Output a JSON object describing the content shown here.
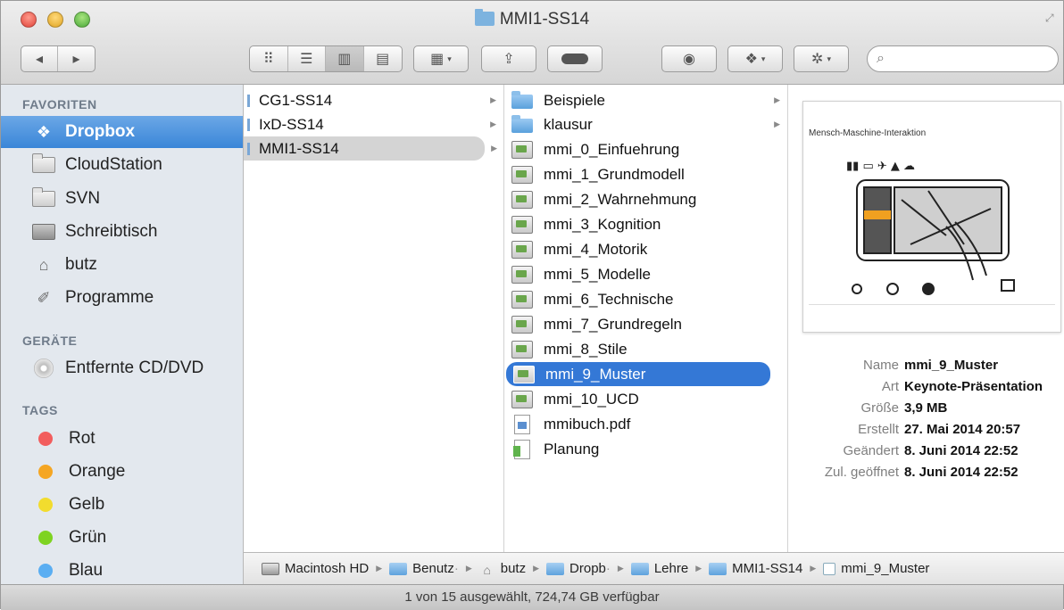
{
  "window": {
    "title": "MMI1-SS14"
  },
  "toolbar": {
    "back_icon": "chevron-left-icon",
    "forward_icon": "chevron-right-icon",
    "view_modes": [
      "icon-view",
      "list-view",
      "column-view",
      "coverflow-view"
    ],
    "active_view": "column-view",
    "search_placeholder": ""
  },
  "sidebar": {
    "favorites_header": "FAVORITEN",
    "favorites": [
      {
        "label": "Dropbox",
        "icon": "dropbox-icon",
        "selected": true
      },
      {
        "label": "CloudStation",
        "icon": "folder-icon"
      },
      {
        "label": "SVN",
        "icon": "folder-icon"
      },
      {
        "label": "Schreibtisch",
        "icon": "desktop-icon"
      },
      {
        "label": "butz",
        "icon": "home-icon"
      },
      {
        "label": "Programme",
        "icon": "applications-icon"
      }
    ],
    "devices_header": "GERÄTE",
    "devices": [
      {
        "label": "Entfernte CD/DVD",
        "icon": "cd-icon"
      }
    ],
    "tags_header": "TAGS",
    "tags": [
      {
        "label": "Rot",
        "color": "#f25d5d"
      },
      {
        "label": "Orange",
        "color": "#f5a623"
      },
      {
        "label": "Gelb",
        "color": "#f2dc2e"
      },
      {
        "label": "Grün",
        "color": "#7ed321"
      },
      {
        "label": "Blau",
        "color": "#5aaef2"
      }
    ]
  },
  "column1": {
    "items": [
      {
        "label": "CG1-SS14"
      },
      {
        "label": "IxD-SS14"
      },
      {
        "label": "MMI1-SS14",
        "open": true
      }
    ]
  },
  "column2": {
    "items": [
      {
        "label": "Beispiele",
        "type": "folder"
      },
      {
        "label": "klausur",
        "type": "folder"
      },
      {
        "label": "mmi_0_Einfuehrung",
        "type": "keynote"
      },
      {
        "label": "mmi_1_Grundmodell",
        "type": "keynote"
      },
      {
        "label": "mmi_2_Wahrnehmung",
        "type": "keynote"
      },
      {
        "label": "mmi_3_Kognition",
        "type": "keynote"
      },
      {
        "label": "mmi_4_Motorik",
        "type": "keynote"
      },
      {
        "label": "mmi_5_Modelle",
        "type": "keynote"
      },
      {
        "label": "mmi_6_Technische",
        "type": "keynote"
      },
      {
        "label": "mmi_7_Grundregeln",
        "type": "keynote"
      },
      {
        "label": "mmi_8_Stile",
        "type": "keynote"
      },
      {
        "label": "mmi_9_Muster",
        "type": "keynote",
        "selected": true
      },
      {
        "label": "mmi_10_UCD",
        "type": "keynote"
      },
      {
        "label": "mmibuch.pdf",
        "type": "pdf"
      },
      {
        "label": "Planung",
        "type": "numbers"
      }
    ]
  },
  "preview": {
    "slide_title": "Mensch-Maschine-Interaktion",
    "info": [
      {
        "key": "Name",
        "value": "mmi_9_Muster"
      },
      {
        "key": "Art",
        "value": "Keynote-Präsentation"
      },
      {
        "key": "Größe",
        "value": "3,9 MB"
      },
      {
        "key": "Erstellt",
        "value": "27. Mai 2014 20:57"
      },
      {
        "key": "Geändert",
        "value": "8. Juni 2014 22:52"
      },
      {
        "key": "Zul. geöffnet",
        "value": "8. Juni 2014 22:52"
      }
    ]
  },
  "pathbar": {
    "crumbs": [
      {
        "label": "Macintosh HD",
        "icon": "hd"
      },
      {
        "label": "Benutz",
        "icon": "fold",
        "truncated": true
      },
      {
        "label": "butz",
        "icon": "home"
      },
      {
        "label": "Dropb",
        "icon": "fold",
        "truncated": true
      },
      {
        "label": "Lehre",
        "icon": "fold"
      },
      {
        "label": "MMI1-SS14",
        "icon": "fold"
      },
      {
        "label": "mmi_9_Muster",
        "icon": "doc"
      }
    ]
  },
  "statusbar": {
    "text": "1 von 15 ausgewählt, 724,74 GB verfügbar"
  }
}
